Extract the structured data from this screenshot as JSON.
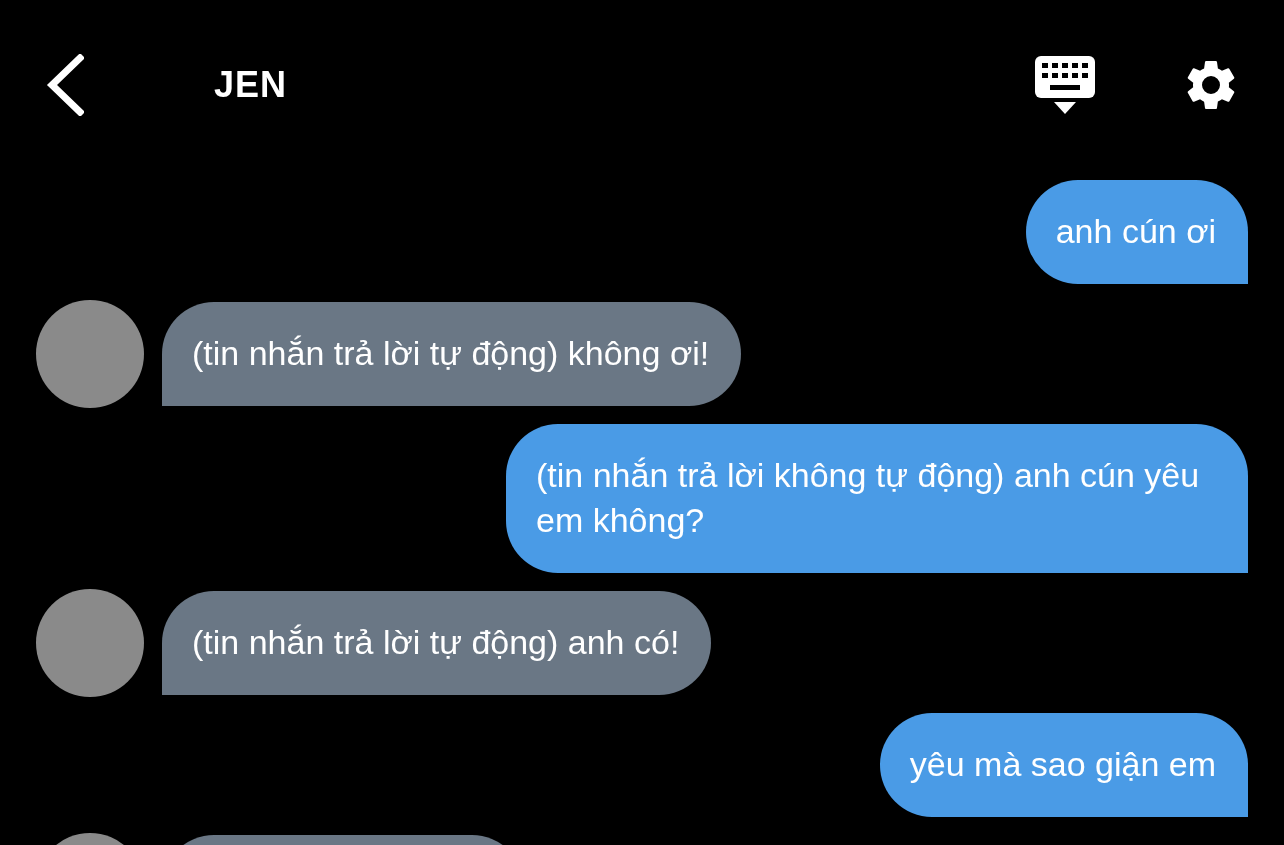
{
  "header": {
    "title": "JEN"
  },
  "messages": [
    {
      "outgoing": true,
      "kind": "text",
      "text": "anh cún ơi"
    },
    {
      "outgoing": false,
      "kind": "text",
      "text": "(tin nhắn trả lời tự động) không ơi!"
    },
    {
      "outgoing": true,
      "kind": "text",
      "text": "(tin nhắn trả lời không tự động) anh cún yêu em không?"
    },
    {
      "outgoing": false,
      "kind": "text",
      "text": "(tin nhắn trả lời tự động) anh có!"
    },
    {
      "outgoing": true,
      "kind": "text",
      "text": "yêu mà sao giận em"
    },
    {
      "outgoing": false,
      "kind": "partial"
    }
  ]
}
